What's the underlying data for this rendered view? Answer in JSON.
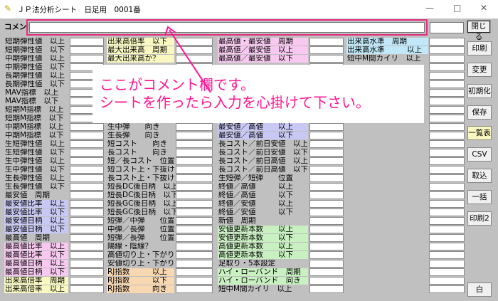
{
  "window": {
    "title": "ＪＰ法分析シート　日足用　0001番",
    "min": "—",
    "max": "□",
    "close": "✕"
  },
  "comment": {
    "label": "コメント",
    "value": ""
  },
  "callout": {
    "line1": "ここがコメント欄です。",
    "line2": "シートを作ったら入力を心掛けて下さい。"
  },
  "side_buttons": [
    "閉じる",
    "印刷",
    "変更",
    "初期化",
    "保存",
    "一覧表",
    "CSV",
    "取込",
    "一括",
    "印刷2",
    "白"
  ],
  "columns": [
    {
      "color": "#c0c0c0",
      "rows": [
        {
          "t": "短期弾性値　以上",
          "c": "#c0c0c0"
        },
        {
          "t": "短期弾性値　以下",
          "c": "#c0c0c0"
        },
        {
          "t": "中期弾性値　以上",
          "c": "#c0c0c0"
        },
        {
          "t": "中期弾性値　以下",
          "c": "#c0c0c0"
        },
        {
          "t": "長期弾性値　以上",
          "c": "#c0c0c0"
        },
        {
          "t": "長期弾性値　以下",
          "c": "#c0c0c0"
        },
        {
          "t": "MAV指標　以上",
          "c": "#c0c0c0"
        },
        {
          "t": "MAV指標　以下",
          "c": "#c0c0c0"
        },
        {
          "t": "短期M指標　以上",
          "c": "#c0c0c0"
        },
        {
          "t": "短期M指標　以下",
          "c": "#c0c0c0"
        },
        {
          "t": "中期M指標　以上",
          "c": "#c0c0c0"
        },
        {
          "t": "中期M指標　以下",
          "c": "#c0c0c0"
        },
        {
          "t": "生短弾性値　以上",
          "c": "#c0c0c0"
        },
        {
          "t": "生短弾性値　以下",
          "c": "#c0c0c0"
        },
        {
          "t": "生中弾性値　以上",
          "c": "#c0c0c0"
        },
        {
          "t": "生中弾性値　以下",
          "c": "#c0c0c0"
        },
        {
          "t": "生長弾性値　以上",
          "c": "#c0c0c0"
        },
        {
          "t": "生長弾性値　以下",
          "c": "#c0c0c0"
        },
        {
          "t": "最安値　周期",
          "c": "#c0c0c0"
        },
        {
          "t": "最安値比率　以上",
          "c": "#c8c8f4"
        },
        {
          "t": "最安値比率　以下",
          "c": "#c8c8f4"
        },
        {
          "t": "最安値日柄　以上",
          "c": "#c8c8f4"
        },
        {
          "t": "最安値日柄　以下",
          "c": "#c8c8f4"
        },
        {
          "t": "最高値　周期",
          "c": "#c0c0c0"
        },
        {
          "t": "最高値比率　以上",
          "c": "#f8c8f0"
        },
        {
          "t": "最高値比率　以下",
          "c": "#f8c8f0"
        },
        {
          "t": "最高値日柄　以上",
          "c": "#f8c8f0"
        },
        {
          "t": "最高値日柄　以下",
          "c": "#f8c8f0"
        },
        {
          "t": "出来高倍率　周期",
          "c": "#f8f8c0"
        },
        {
          "t": "出来高倍率　以上",
          "c": "#f8f8c0"
        }
      ]
    },
    {
      "rows": [
        {
          "t": "出来高倍率　以下",
          "c": "#f8f8c0"
        },
        {
          "t": "最大出来高　周期",
          "c": "#f8f8c0"
        },
        {
          "t": "最大出来高か？",
          "c": "#f8f8c0"
        },
        {
          "t": "",
          "c": "#c0c0c0"
        },
        {
          "t": "",
          "c": "#c0c0c0"
        },
        {
          "t": "",
          "c": "#c0c0c0"
        },
        {
          "t": "",
          "c": "#c0c0c0"
        },
        {
          "t": "",
          "c": "#c0c0c0"
        },
        {
          "t": "",
          "c": "#c0c0c0"
        },
        {
          "t": "",
          "c": "#c0c0c0"
        },
        {
          "t": "生中弾　　向き",
          "c": "#c0c0c0"
        },
        {
          "t": "生長弾　　向き",
          "c": "#c0c0c0"
        },
        {
          "t": "短コスト　　向き",
          "c": "#c0c0c0"
        },
        {
          "t": "長コスト　　向き",
          "c": "#c0c0c0"
        },
        {
          "t": "短／長コスト　位置",
          "c": "#c0c0c0"
        },
        {
          "t": "短コスト上・下抜け",
          "c": "#c0c0c0"
        },
        {
          "t": "長コスト上・下抜け",
          "c": "#c0c0c0"
        },
        {
          "t": "短長DC後日柄　以上",
          "c": "#c0c0c0"
        },
        {
          "t": "短長DC後日柄　以下",
          "c": "#c0c0c0"
        },
        {
          "t": "短長GC後日柄　以上",
          "c": "#c0c0c0"
        },
        {
          "t": "短長GC後日柄　以下",
          "c": "#c0c0c0"
        },
        {
          "t": "短弾／中弾　　位置",
          "c": "#c0c0c0"
        },
        {
          "t": "中弾／長弾　　位置",
          "c": "#c0c0c0"
        },
        {
          "t": "短弾／長弾　　位置",
          "c": "#c0c0c0"
        },
        {
          "t": "陽線・陰線？",
          "c": "#c0c0c0"
        },
        {
          "t": "高値切り上・下がり",
          "c": "#c0c0c0"
        },
        {
          "t": "安値切り上・下がり",
          "c": "#c0c0c0"
        },
        {
          "t": "RJ指数　　　以上",
          "c": "#f8d8b0"
        },
        {
          "t": "RJ指数　　　以下",
          "c": "#f8d8b0"
        },
        {
          "t": "RJ指数　　　向き",
          "c": "#f8d8b0"
        }
      ]
    },
    {
      "rows": [
        {
          "t": "最高値・最安値　周期",
          "c": "#f8c8f0"
        },
        {
          "t": "最高値／最安値　以上",
          "c": "#f8c8f0"
        },
        {
          "t": "最高値／最安値　以下",
          "c": "#f8c8f0"
        },
        {
          "t": "",
          "c": "#c0c0c0"
        },
        {
          "t": "",
          "c": "#c0c0c0"
        },
        {
          "t": "",
          "c": "#c0c0c0"
        },
        {
          "t": "",
          "c": "#c0c0c0"
        },
        {
          "t": "",
          "c": "#c0c0c0"
        },
        {
          "t": "",
          "c": "#c0c0c0"
        },
        {
          "t": "",
          "c": "#c0c0c0"
        },
        {
          "t": "最安値／高値　　以上",
          "c": "#c8c8f4"
        },
        {
          "t": "最安値／高値　　以下",
          "c": "#c8c8f4"
        },
        {
          "t": "長コスト／前日安値　以上",
          "c": "#c0c0c0"
        },
        {
          "t": "長コスト／前日安値　以下",
          "c": "#c0c0c0"
        },
        {
          "t": "長コスト／前日高値　以上",
          "c": "#c0c0c0"
        },
        {
          "t": "長コスト／前日高値　以下",
          "c": "#c0c0c0"
        },
        {
          "t": "生短弾／短弾　　位置",
          "c": "#c0c0c0"
        },
        {
          "t": "終値／高値　　　以上",
          "c": "#c0c0c0"
        },
        {
          "t": "終値／高値　　　以下",
          "c": "#c0c0c0"
        },
        {
          "t": "終値／安値　　　以上",
          "c": "#c0c0c0"
        },
        {
          "t": "終値／安値　　　以下",
          "c": "#c0c0c0"
        },
        {
          "t": "新値　周期",
          "c": "#c0c0c0"
        },
        {
          "t": "安値更新本数　　以上",
          "c": "#c8f0c0"
        },
        {
          "t": "安値更新本数　　以下",
          "c": "#c8f0c0"
        },
        {
          "t": "高値更新本数　　以上",
          "c": "#c8f0c0"
        },
        {
          "t": "高値更新本数　　以下",
          "c": "#c8f0c0"
        },
        {
          "t": "足取り・5本設定",
          "c": "#c0c0c0"
        },
        {
          "t": "ハイ・ローバンド　周期",
          "c": "#c8f0c0"
        },
        {
          "t": "ハイ・ローバンド　向き",
          "c": "#c8f0c0"
        },
        {
          "t": "短中M間カイリ　以上",
          "c": "#c0c0c0"
        }
      ]
    },
    {
      "rows": [
        {
          "t": "出来高水準　周期",
          "c": "#c0e8f8"
        },
        {
          "t": "出来高水準　　　以上",
          "c": "#c0e8f8"
        },
        {
          "t": "短中M間カイリ　以上",
          "c": "#c0c0c0"
        }
      ]
    }
  ]
}
